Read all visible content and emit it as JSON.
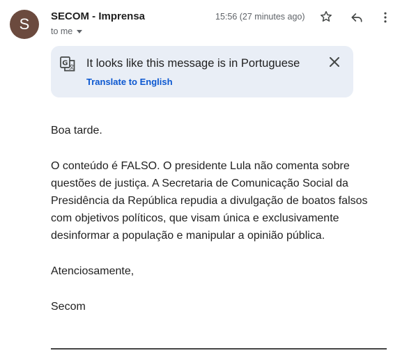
{
  "message": {
    "sender": {
      "initial": "S",
      "name": "SECOM - Imprensa",
      "avatar_color": "#6b4a3e"
    },
    "to_label": "to me",
    "timestamp": "15:56 (27 minutes ago)",
    "actions": {
      "star_icon": "star-outline-icon",
      "reply_icon": "reply-icon",
      "more_icon": "more-vertical-icon"
    }
  },
  "translate_banner": {
    "message": "It looks like this message is in Portuguese",
    "link_label": "Translate to English",
    "background": "#e9eef6",
    "link_color": "#0b57d0"
  },
  "body": {
    "greeting": "Boa tarde.",
    "paragraph": "O conteúdo é FALSO. O presidente Lula não comenta sobre questões de justiça. A Secretaria de Comunicação Social da Presidência da República repudia a divulgação de boatos falsos com objetivos políticos, que visam única e exclusivamente desinformar a população e manipular a opinião pública.",
    "closing": "Atenciosamente,",
    "signature": "Secom"
  }
}
